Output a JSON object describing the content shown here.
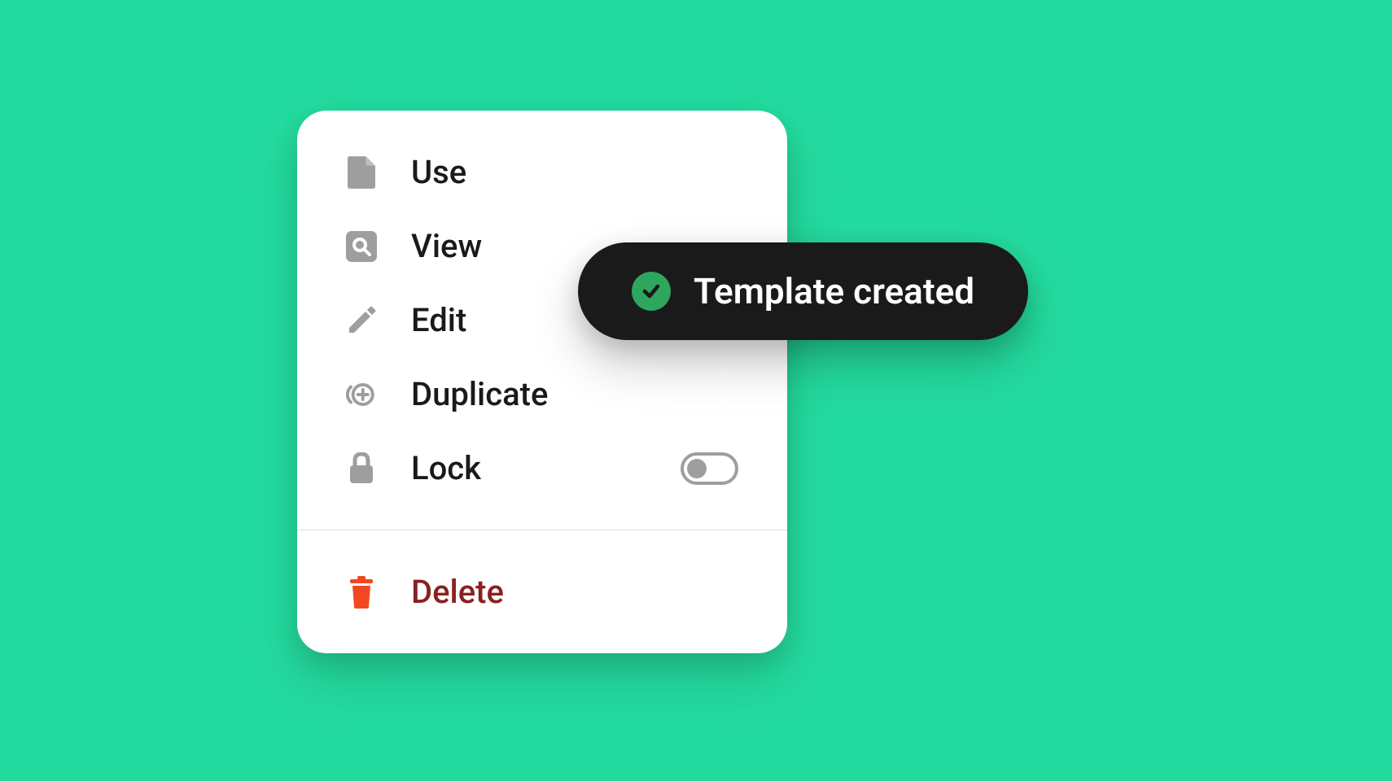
{
  "menu": {
    "items": [
      {
        "label": "Use",
        "icon": "document-icon"
      },
      {
        "label": "View",
        "icon": "magnify-icon"
      },
      {
        "label": "Edit",
        "icon": "pencil-icon"
      },
      {
        "label": "Duplicate",
        "icon": "duplicate-icon"
      },
      {
        "label": "Lock",
        "icon": "lock-icon",
        "toggle": false
      }
    ],
    "delete": {
      "label": "Delete",
      "icon": "trash-icon"
    }
  },
  "toast": {
    "message": "Template created"
  },
  "colors": {
    "background": "#24DB9F",
    "card": "#FFFFFF",
    "toast": "#1A1A1A",
    "success": "#2EA65E",
    "iconGrey": "#9E9E9E",
    "danger": "#F24822",
    "dangerText": "#8B2020"
  }
}
